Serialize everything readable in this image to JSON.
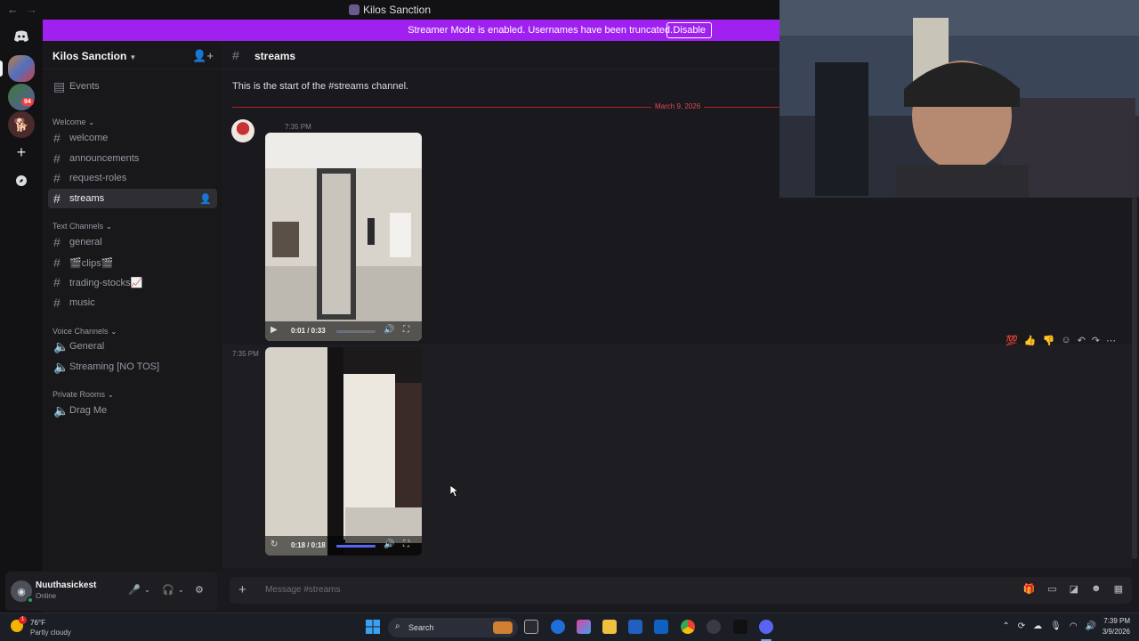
{
  "window": {
    "title": "Kilos Sanction"
  },
  "banner": {
    "message": "Streamer Mode is enabled. Usernames have been truncated.",
    "button": "Disable"
  },
  "server": {
    "name": "Kilos Sanction",
    "events": "Events"
  },
  "rail": {
    "badge": "94"
  },
  "categories": {
    "welcome": "Welcome",
    "text": "Text Channels",
    "voice": "Voice Channels",
    "private": "Private Rooms"
  },
  "channels": {
    "welcome": "welcome",
    "announcements": "announcements",
    "request_roles": "request-roles",
    "streams": "streams",
    "general": "general",
    "clips": "🎬clips🎬",
    "trading": "trading-stocks📈",
    "music": "music",
    "voice_general": "General",
    "voice_streaming": "Streaming [NO TOS]",
    "drag_me": "Drag Me"
  },
  "chat": {
    "channel": "streams",
    "start_text": "This is the start of the #streams channel.",
    "date_divider": "March 9, 2026",
    "messages": [
      {
        "time": "7:35 PM",
        "video_time": "0:01 / 0:33",
        "progress": 0.03
      },
      {
        "time": "7:35 PM",
        "video_time": "0:18 / 0:18",
        "progress": 1.0
      }
    ]
  },
  "composer": {
    "placeholder": "Message #streams"
  },
  "user": {
    "name": "Nuuthasickest",
    "status": "Online"
  },
  "taskbar": {
    "weather_temp": "76°F",
    "weather_desc": "Partly cloudy",
    "weather_badge": "1",
    "search": "Search",
    "time": "7:39 PM",
    "date": "3/9/2026"
  }
}
